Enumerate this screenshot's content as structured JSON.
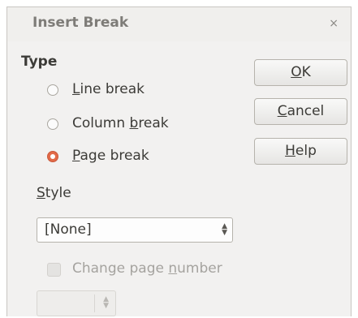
{
  "window": {
    "title": "Insert Break",
    "close_glyph": "×"
  },
  "type_section": {
    "label": "Type",
    "options": [
      {
        "pre": "",
        "key": "L",
        "post": "ine break",
        "checked": false
      },
      {
        "pre": "Column ",
        "key": "b",
        "post": "reak",
        "checked": false
      },
      {
        "pre": "",
        "key": "P",
        "post": "age break",
        "checked": true
      }
    ]
  },
  "style_section": {
    "label_key": "S",
    "label_rest": "tyle",
    "selected": "[None]"
  },
  "change_page_number": {
    "pre": "Change page ",
    "key": "n",
    "post": "umber",
    "checked": false,
    "enabled": false,
    "value": ""
  },
  "buttons": {
    "ok": {
      "key": "O",
      "rest": "K"
    },
    "cancel": {
      "key": "C",
      "rest": "ancel"
    },
    "help": {
      "key": "H",
      "rest": "elp"
    }
  },
  "colors": {
    "accent": "#e26a48",
    "dialog_bg": "#f2f1f0",
    "text": "#3c3b37",
    "disabled_text": "#a5a39f"
  }
}
